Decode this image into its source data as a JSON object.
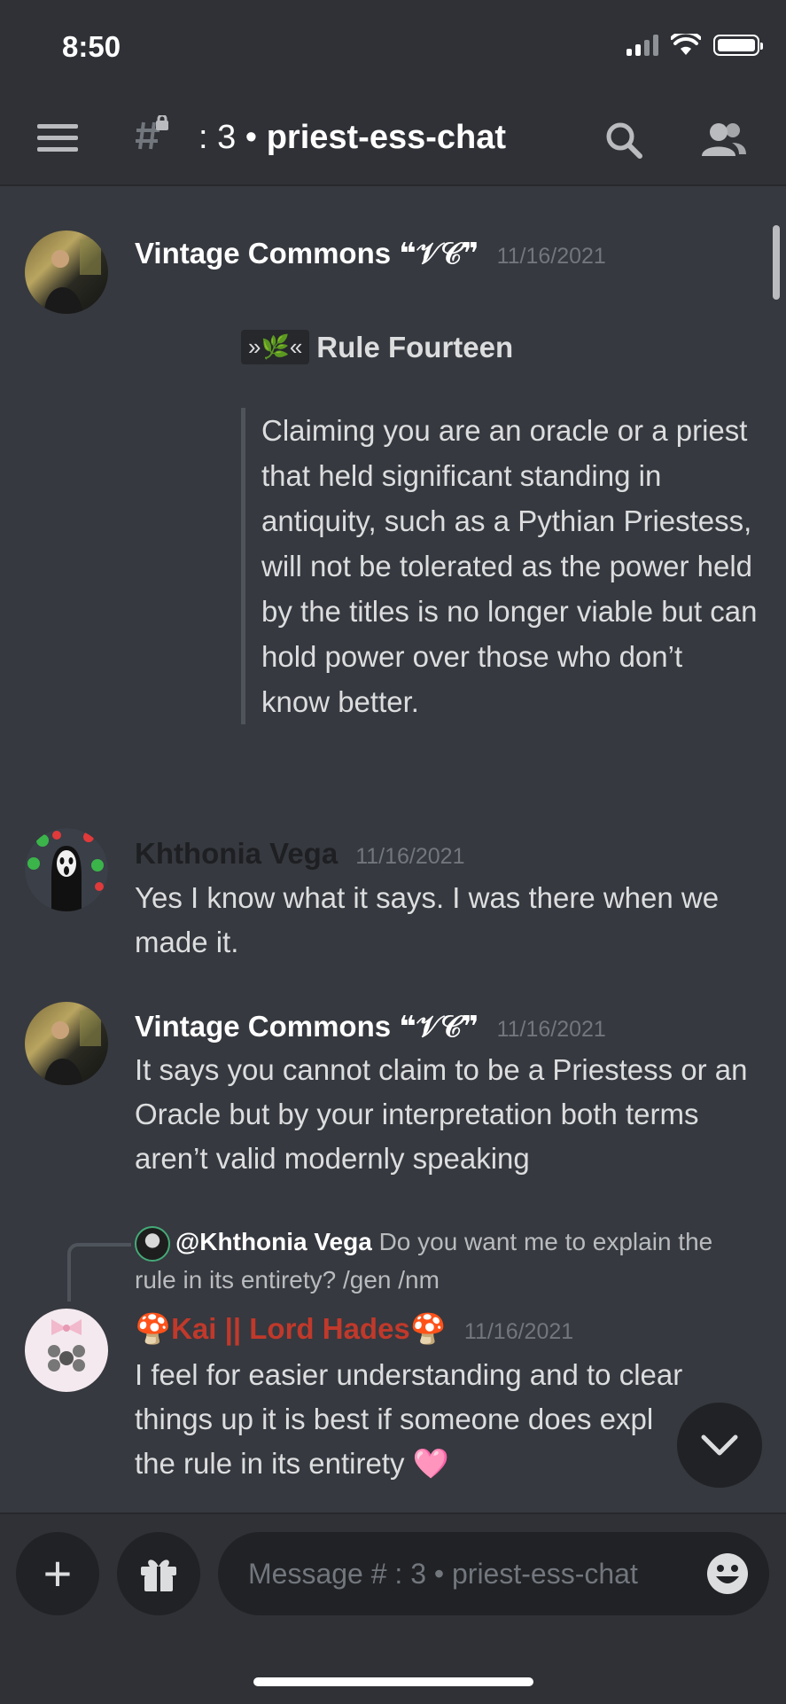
{
  "status_bar": {
    "time": "8:50"
  },
  "header": {
    "menu_icon": "hamburger-menu-icon",
    "channel_prefix": ": 3 •",
    "channel_name": "priest-ess-chat",
    "search_icon": "search-icon",
    "members_icon": "members-icon"
  },
  "messages": [
    {
      "author": "Vintage Commons ❝𝒱𝒞❞",
      "timestamp": "11/16/2021",
      "rule_emoji": "»🌿«",
      "rule_title": "Rule Fourteen",
      "quote": "Claiming you are an oracle or a priest that held significant standing in antiquity, such as a Pythian Priestess, will not be tolerated as the power held by the titles is no longer viable but can hold power over those who don’t know better."
    },
    {
      "author": "Khthonia Vega",
      "timestamp": "11/16/2021",
      "text": "Yes I know what it says. I was there when we made it."
    },
    {
      "author": "Vintage Commons ❝𝒱𝒞❞",
      "timestamp": "11/16/2021",
      "text": "It says you cannot claim to be a Priestess or an Oracle but by your interpretation both terms aren’t valid modernly speaking"
    },
    {
      "reply_to": "@Khthonia Vega",
      "reply_preview": "Do you want me to explain the rule in its entirety? /gen /nm",
      "author_prefix": "🍄",
      "author": "Kai || Lord Hades",
      "author_suffix": "🍄",
      "author_color": "#c0392b",
      "timestamp": "11/16/2021",
      "text": "I feel for easier understanding and to clear things up it is best if someone does expl",
      "text_tail": "the rule in its entirety",
      "heart": "🩷"
    }
  ],
  "composer": {
    "placeholder": "Message # : 3 • priest-ess-chat",
    "add_icon": "plus-icon",
    "gift_icon": "gift-icon",
    "emoji_icon": "emoji-icon"
  },
  "scroll_button_icon": "chevron-down-icon"
}
